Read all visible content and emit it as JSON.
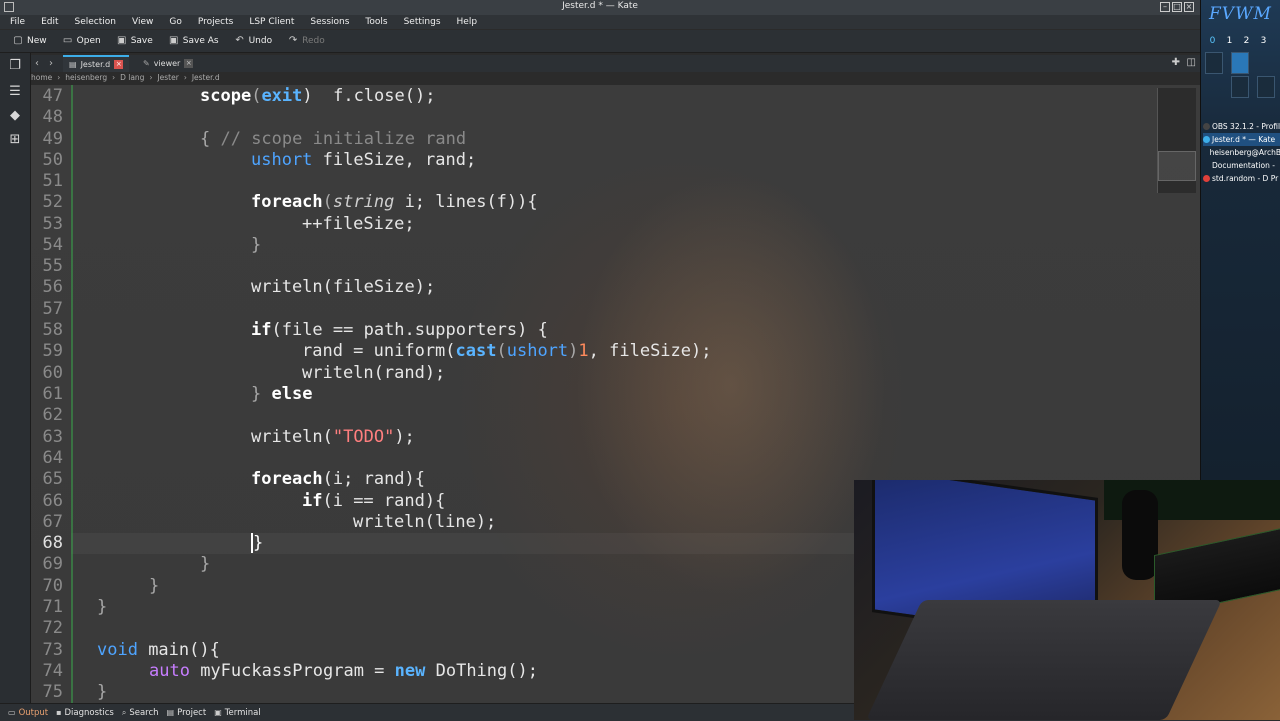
{
  "window": {
    "title": "Jester.d * — Kate"
  },
  "menu": [
    "File",
    "Edit",
    "Selection",
    "View",
    "Go",
    "Projects",
    "LSP Client",
    "Sessions",
    "Tools",
    "Settings",
    "Help"
  ],
  "toolbar": {
    "new": "New",
    "open": "Open",
    "save": "Save",
    "save_as": "Save As",
    "undo": "Undo",
    "redo": "Redo"
  },
  "tabs": [
    {
      "label": "Jester.d",
      "active": true
    },
    {
      "label": "viewer",
      "active": false
    }
  ],
  "breadcrumb": [
    "home",
    "heisenberg",
    "D lang",
    "Jester",
    "Jester.d"
  ],
  "editor": {
    "lines": [
      {
        "n": "47"
      },
      {
        "n": "48"
      },
      {
        "n": "49"
      },
      {
        "n": "50"
      },
      {
        "n": "51"
      },
      {
        "n": "52"
      },
      {
        "n": "53"
      },
      {
        "n": "54"
      },
      {
        "n": "55"
      },
      {
        "n": "56"
      },
      {
        "n": "57"
      },
      {
        "n": "58"
      },
      {
        "n": "59"
      },
      {
        "n": "60"
      },
      {
        "n": "61"
      },
      {
        "n": "62"
      },
      {
        "n": "63"
      },
      {
        "n": "64"
      },
      {
        "n": "65"
      },
      {
        "n": "66"
      },
      {
        "n": "67"
      },
      {
        "n": "68"
      },
      {
        "n": "69"
      },
      {
        "n": "70"
      },
      {
        "n": "71"
      },
      {
        "n": "72"
      },
      {
        "n": "73"
      },
      {
        "n": "74"
      },
      {
        "n": "75"
      }
    ],
    "code": {
      "l47_a": "scope",
      "l47_b": "(",
      "l47_c": "exit",
      "l47_d": ")  f.close();",
      "l49_a": "{ ",
      "l49_b": "// scope initialize rand",
      "l50_a": "ushort",
      "l50_b": " fileSize, rand;",
      "l52_a": "foreach",
      "l52_b": "(",
      "l52_c": "string",
      "l52_d": " i; lines(f)){",
      "l53": "++fileSize;",
      "l54": "}",
      "l56": "writeln(fileSize);",
      "l58_a": "if",
      "l58_b": "(file == path.supporters) {",
      "l59_a": "rand = uniform(",
      "l59_b": "cast",
      "l59_c": "(",
      "l59_d": "ushort",
      "l59_e": ")",
      "l59_f": "1",
      "l59_g": ", fileSize);",
      "l60": "writeln(rand);",
      "l61_a": "} ",
      "l61_b": "else",
      "l63_a": "writeln(",
      "l63_b": "\"TODO\"",
      "l63_c": ");",
      "l65_a": "foreach",
      "l65_b": "(i; rand){",
      "l66_a": "if",
      "l66_b": "(i == rand){",
      "l67": "writeln(line);",
      "l68": "}",
      "l69": "}",
      "l70": "}",
      "l71": "}",
      "l73_a": "void",
      "l73_b": " main(){",
      "l74_a": "auto",
      "l74_b": " myFuckassProgram = ",
      "l74_c": "new",
      "l74_d": " DoThing();",
      "l75": "}"
    }
  },
  "statusbar": [
    "Output",
    "Diagnostics",
    "Search",
    "Project",
    "Terminal"
  ],
  "wm": {
    "logo": "FVWM",
    "desks": [
      "0",
      "1",
      "2",
      "3"
    ],
    "windows": [
      {
        "label": "OBS 32.1.2 - Profil",
        "color": "#444444"
      },
      {
        "label": "Jester.d * — Kate",
        "color": "#3daee9"
      },
      {
        "label": "heisenberg@ArchB",
        "color": ""
      },
      {
        "label": "Documentation - ",
        "color": ""
      },
      {
        "label": "std.random - D Pr",
        "color": "#e0403a"
      }
    ]
  },
  "icons": {
    "app": "kate-icon",
    "new": "new-file-icon",
    "open": "folder-open-icon",
    "save": "save-icon",
    "save_as": "save-as-icon",
    "undo": "undo-icon",
    "redo": "redo-icon"
  }
}
